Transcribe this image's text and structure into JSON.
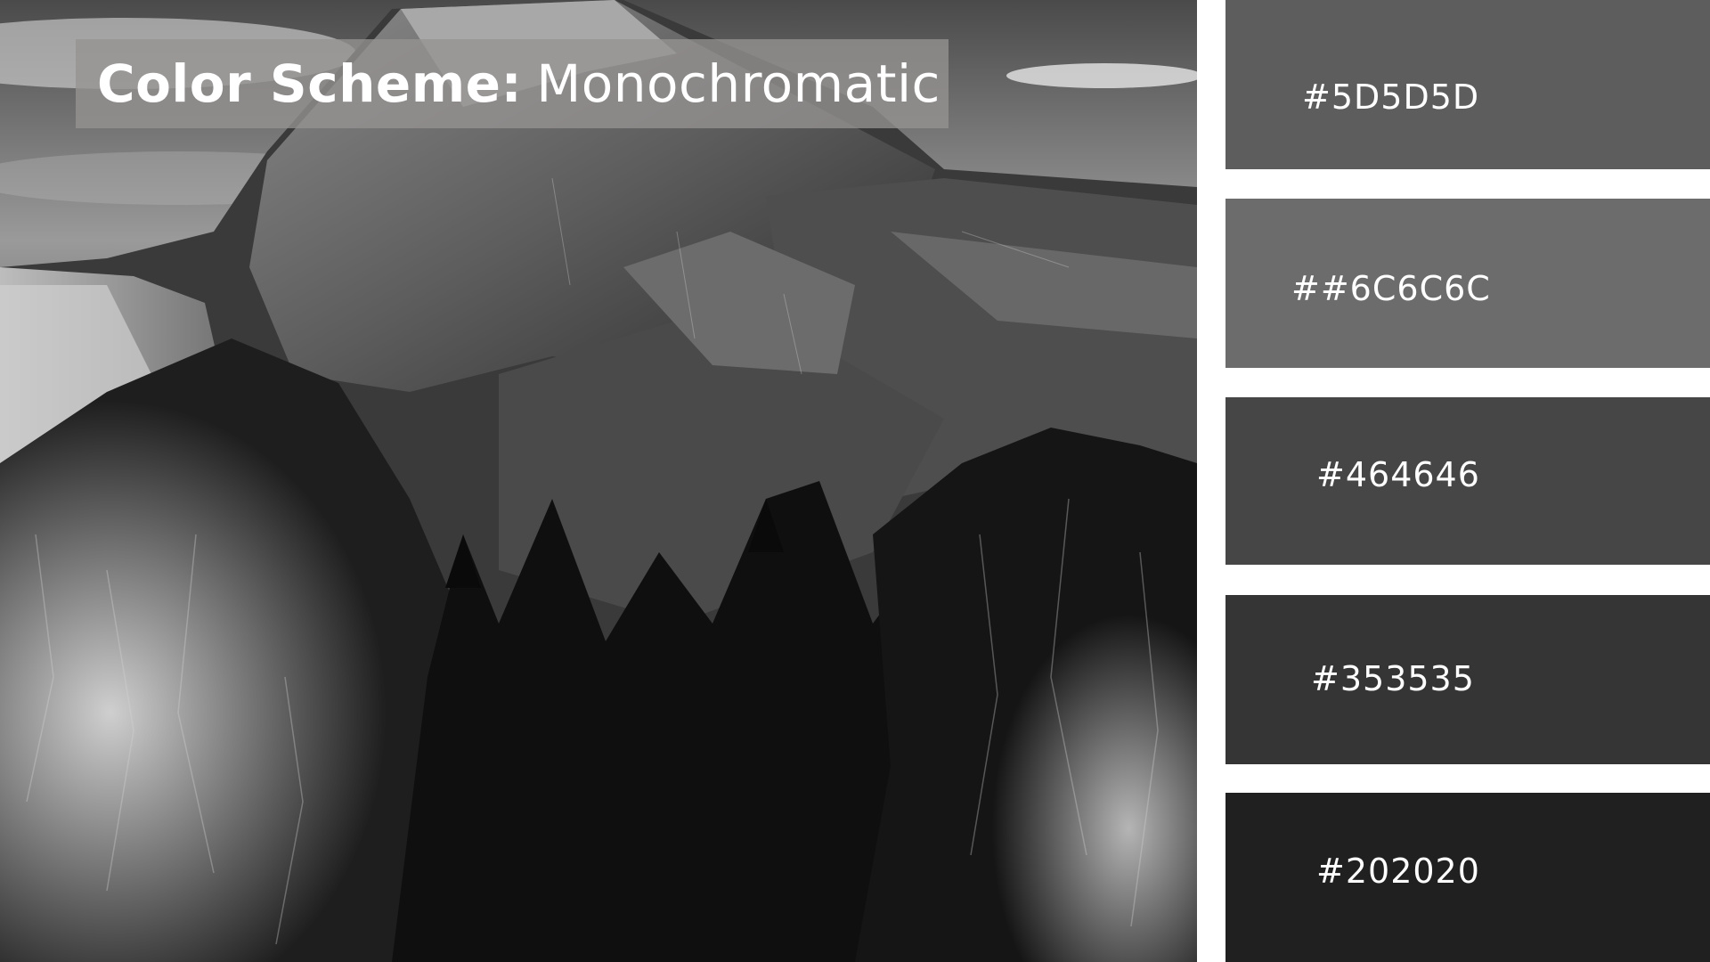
{
  "title": {
    "bold": "Color Scheme:",
    "light": "Monochromatic"
  },
  "photo": {
    "description_icon": "mountain-landscape-photo"
  },
  "swatches": [
    {
      "label": "#5D5D5D",
      "color": "#5D5D5D"
    },
    {
      "label": "##6C6C6C",
      "color": "#6C6C6C"
    },
    {
      "label": "#464646",
      "color": "#464646"
    },
    {
      "label": "#353535",
      "color": "#353535"
    },
    {
      "label": "#202020",
      "color": "#202020"
    }
  ]
}
